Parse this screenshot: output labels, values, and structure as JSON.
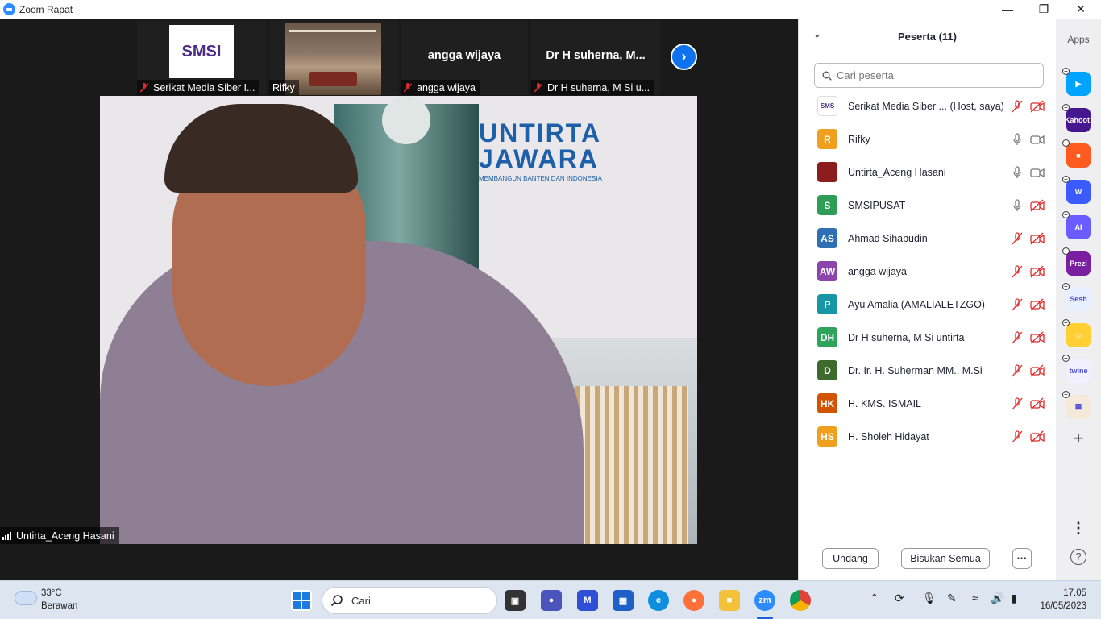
{
  "window": {
    "title": "Zoom Rapat"
  },
  "thumbnails": [
    {
      "name": "Serikat Media Siber I...",
      "logo_text": "SMSI",
      "muted": true
    },
    {
      "name": "Rifky",
      "muted": false
    },
    {
      "name": "angga wijaya",
      "big_name": "angga wijaya",
      "muted": true
    },
    {
      "name": "Dr H suherna, M Si u...",
      "big_name": "Dr H suherna, M...",
      "muted": true
    }
  ],
  "main_video": {
    "speaker": "Untirta_Aceng Hasani",
    "banner_line1": "UNTIRTA",
    "banner_line2": "JAWARA",
    "banner_sub": "MEMBANGUN BANTEN DAN INDONESIA"
  },
  "participants_panel": {
    "title": "Peserta (11)",
    "search_placeholder": "Cari peserta",
    "participants": [
      {
        "name": "Serikat Media Siber ... (Host, saya)",
        "initials": "SMS",
        "color": "#ffffff",
        "mic": "muted",
        "video": "off"
      },
      {
        "name": "Rifky",
        "initials": "R",
        "color": "#f0a01e",
        "mic": "on",
        "video": "on"
      },
      {
        "name": "Untirta_Aceng Hasani",
        "initials": "",
        "color": "#8b1d1d",
        "mic": "on",
        "video": "on"
      },
      {
        "name": "SMSIPUSAT",
        "initials": "S",
        "color": "#2e9e57",
        "mic": "on",
        "video": "off"
      },
      {
        "name": "Ahmad Sihabudin",
        "initials": "AS",
        "color": "#2f6fb5",
        "mic": "muted",
        "video": "off"
      },
      {
        "name": "angga wijaya",
        "initials": "AW",
        "color": "#8e44ad",
        "mic": "muted",
        "video": "off"
      },
      {
        "name": "Ayu Amalia (AMALIALETZGO)",
        "initials": "P",
        "color": "#1797a6",
        "mic": "muted",
        "video": "off"
      },
      {
        "name": "Dr H suherna, M Si untirta",
        "initials": "DH",
        "color": "#2ea35a",
        "mic": "muted",
        "video": "off"
      },
      {
        "name": "Dr. Ir. H. Suherman MM., M.Si",
        "initials": "D",
        "color": "#3d6b2e",
        "mic": "muted",
        "video": "off"
      },
      {
        "name": "H. KMS. ISMAIL",
        "initials": "HK",
        "color": "#d35400",
        "mic": "muted",
        "video": "off"
      },
      {
        "name": "H. Sholeh Hidayat",
        "initials": "HS",
        "color": "#f0a01e",
        "mic": "muted",
        "video": "off"
      }
    ],
    "invite_label": "Undang",
    "mute_all_label": "Bisukan Semua",
    "more_label": "···"
  },
  "apps_bar": {
    "label": "Apps",
    "apps": [
      {
        "name": "app-1",
        "text": "▶",
        "color": "#00a3ff"
      },
      {
        "name": "kahoot",
        "text": "Kahoot!",
        "color": "#46178f"
      },
      {
        "name": "app-3",
        "text": "■",
        "color": "#ff5a1f"
      },
      {
        "name": "app-w",
        "text": "W",
        "color": "#3b5bfd"
      },
      {
        "name": "app-ai",
        "text": "AI",
        "color": "#6a5cff"
      },
      {
        "name": "prezi",
        "text": "Prezi",
        "color": "#7a1fa2"
      },
      {
        "name": "sesh",
        "text": "Sesh",
        "color": "#e8f0ff"
      },
      {
        "name": "app-emoji",
        "text": "☺",
        "color": "#ffcf33"
      },
      {
        "name": "twine",
        "text": "twine",
        "color": "#f2f0ff"
      },
      {
        "name": "app-grid",
        "text": "▦",
        "color": "#f5e9dc"
      }
    ]
  },
  "taskbar": {
    "weather_temp": "33°C",
    "weather_desc": "Berawan",
    "search_label": "Cari",
    "time": "17.05",
    "date": "16/05/2023"
  }
}
